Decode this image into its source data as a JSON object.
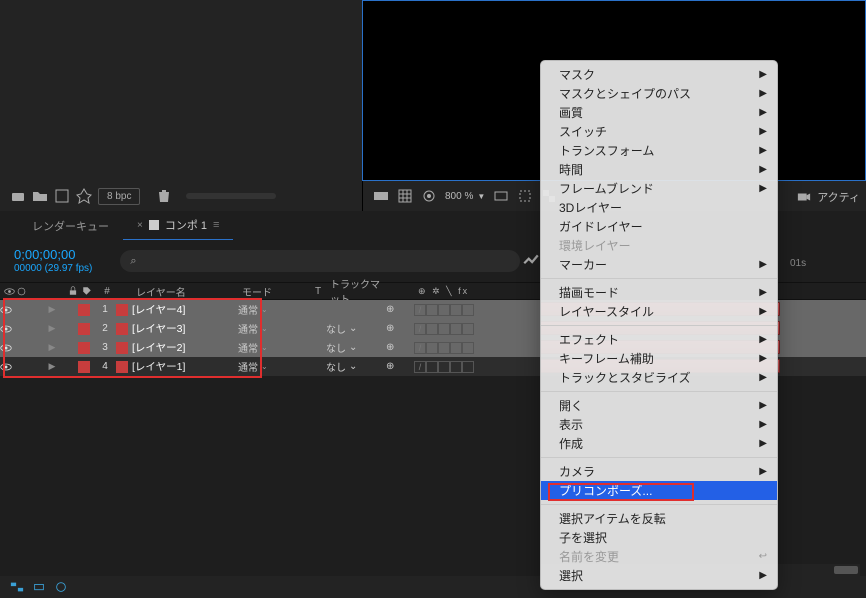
{
  "project_footer": {
    "bpc": "8 bpc"
  },
  "viewer_footer": {
    "zoom": "800 %"
  },
  "viewer_right": {
    "active_label": "アクティ"
  },
  "tabs": {
    "render_queue": "レンダーキュー",
    "comp_name": "コンポ 1"
  },
  "timecode": {
    "time": "0;00;00;00",
    "fps": "00000 (29.97 fps)"
  },
  "time_ruler": {
    "tick1": "01s"
  },
  "columns": {
    "num": "#",
    "layer_name": "レイヤー名",
    "mode": "モード",
    "t": "T",
    "track_matte": "トラックマット",
    "flag_header": "単※＼fx"
  },
  "layers": [
    {
      "num": "1",
      "name": "[レイヤー4]",
      "mode": "通常",
      "track": ""
    },
    {
      "num": "2",
      "name": "[レイヤー3]",
      "mode": "通常",
      "track": "なし"
    },
    {
      "num": "3",
      "name": "[レイヤー2]",
      "mode": "通常",
      "track": "なし"
    },
    {
      "num": "4",
      "name": "[レイヤー1]",
      "mode": "通常",
      "track": "なし"
    }
  ],
  "menu": {
    "mask": "マスク",
    "mask_shape_path": "マスクとシェイプのパス",
    "quality": "画質",
    "switch": "スイッチ",
    "transform": "トランスフォーム",
    "time": "時間",
    "frame_blend": "フレームブレンド",
    "three_d_layer": "3Dレイヤー",
    "guide_layer": "ガイドレイヤー",
    "env_layer": "環境レイヤー",
    "marker": "マーカー",
    "draw_mode": "描画モード",
    "layer_style": "レイヤースタイル",
    "effect": "エフェクト",
    "keyframe_assist": "キーフレーム補助",
    "track_stabilize": "トラックとスタビライズ",
    "open": "開く",
    "display": "表示",
    "create": "作成",
    "camera": "カメラ",
    "precompose": "プリコンポーズ...",
    "invert_selection": "選択アイテムを反転",
    "select_children": "子を選択",
    "rename": "名前を変更",
    "select": "選択"
  },
  "colors": {
    "layer_color": "#c73d3d",
    "accent": "#2a71c9",
    "menu_highlight": "#2360e6",
    "callout": "#e02e2e"
  }
}
